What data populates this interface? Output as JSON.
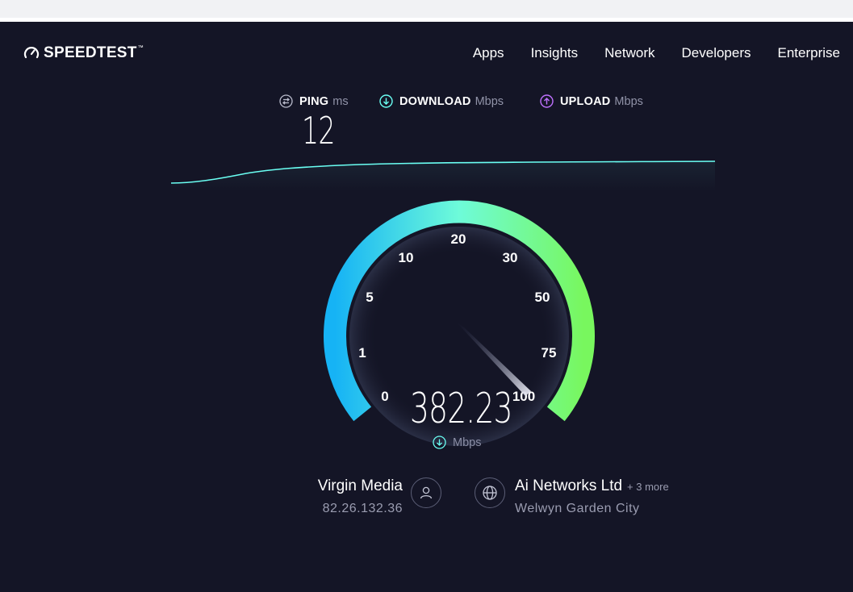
{
  "header": {
    "logo_text": "SPEEDTEST",
    "logo_mark": "™",
    "nav": [
      "Apps",
      "Insights",
      "Network",
      "Developers",
      "Enterprise"
    ]
  },
  "results": {
    "ping": {
      "label": "PING",
      "unit": "ms",
      "value": "12",
      "icon": "ping-icon"
    },
    "download": {
      "label": "DOWNLOAD",
      "unit": "Mbps",
      "icon": "download-arrow-icon"
    },
    "upload": {
      "label": "UPLOAD",
      "unit": "Mbps",
      "icon": "upload-arrow-icon"
    }
  },
  "gauge": {
    "ticks": [
      "0",
      "1",
      "5",
      "10",
      "20",
      "30",
      "50",
      "75",
      "100"
    ],
    "value": "382.23",
    "unit": "Mbps"
  },
  "provider": {
    "name": "Virgin Media",
    "ip": "82.26.132.36",
    "icon": "user-icon"
  },
  "server": {
    "name": "Ai Networks Ltd",
    "more": "+ 3 more",
    "city": "Welwyn Garden City",
    "icon": "globe-icon"
  },
  "colors": {
    "background": "#141526",
    "download": "#6afff3",
    "upload": "#bf71ff",
    "gauge_start": "#16b3f5",
    "gauge_mid": "#6efbd9",
    "gauge_end": "#78f75e"
  }
}
